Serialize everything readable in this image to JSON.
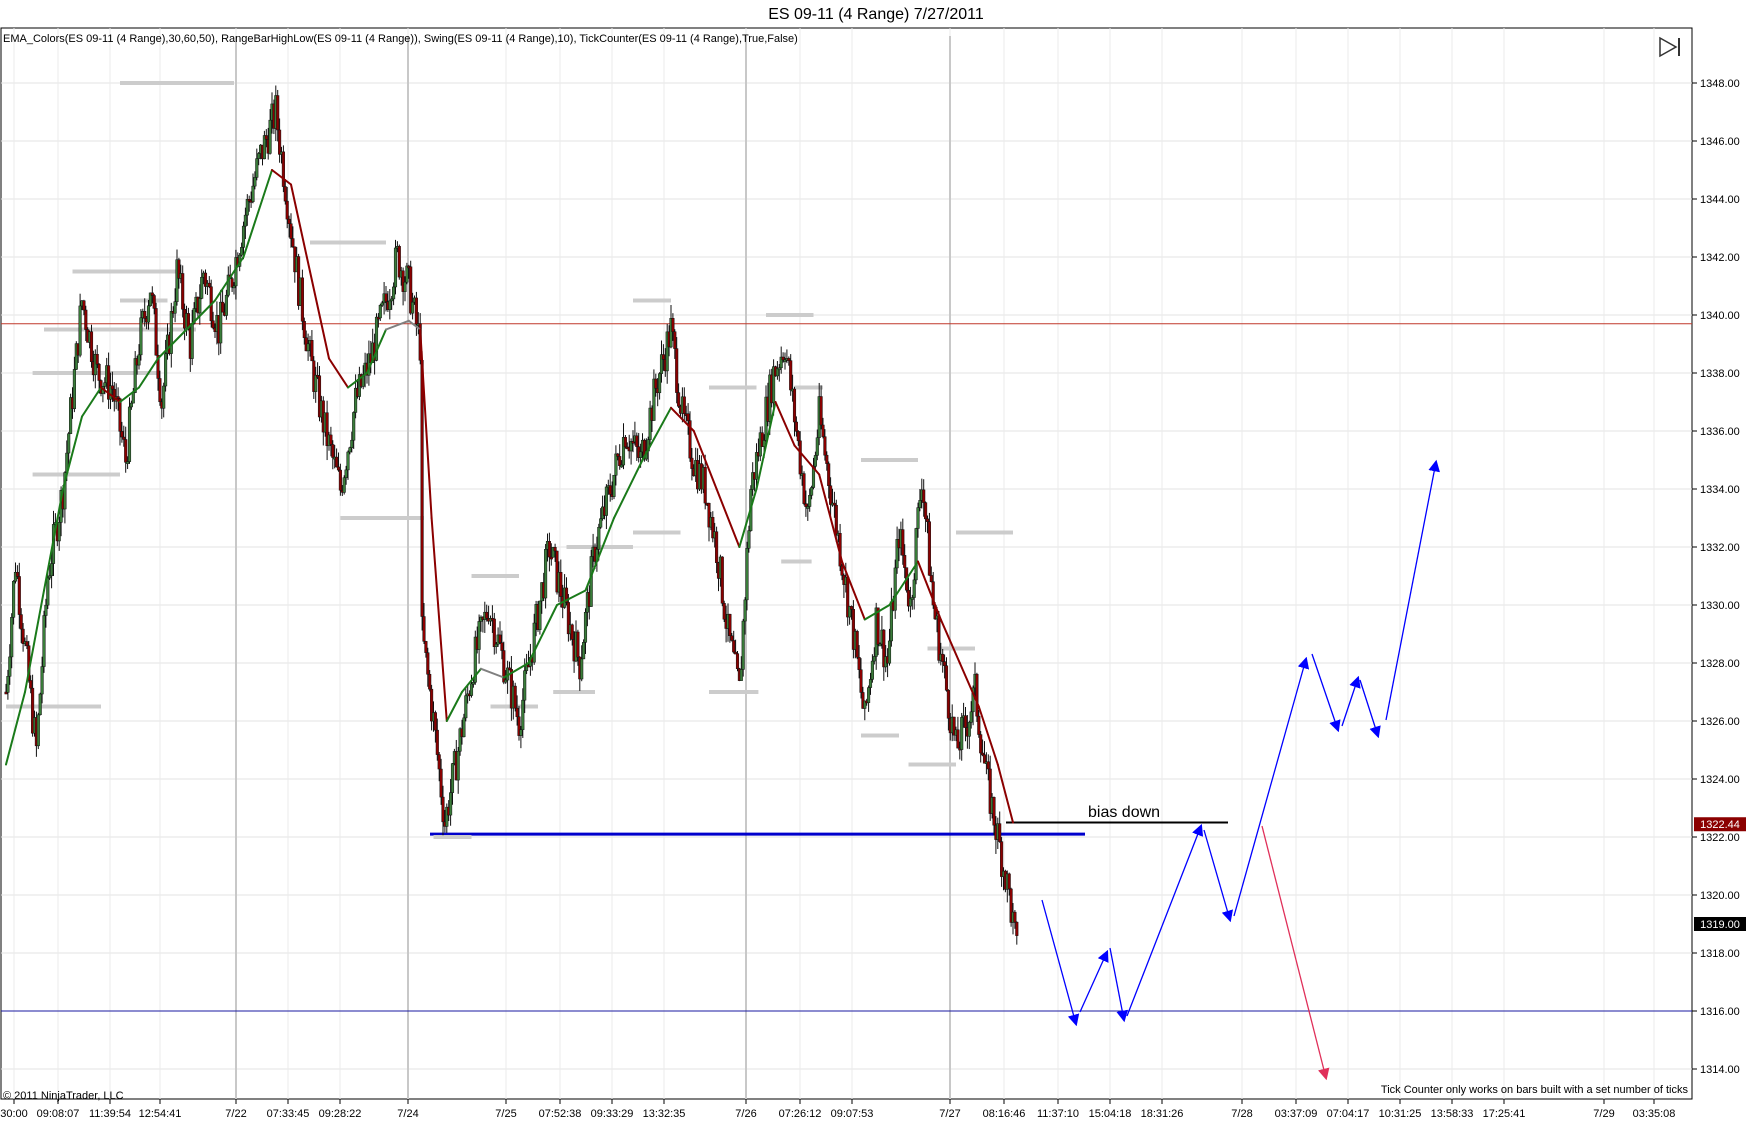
{
  "window": {
    "title": "ES 09-11 (4 Range)  7/27/2011",
    "indicator_line": "EMA_Colors(ES 09-11 (4 Range),30,60,50), RangeBarHighLow(ES 09-11 (4 Range)), Swing(ES 09-11 (4 Range),10), TickCounter(ES 09-11 (4 Range),True,False)",
    "copyright": "© 2011 NinjaTrader, LLC",
    "tick_counter_note": "Tick Counter only works on bars built with a set number of ticks"
  },
  "icons": {
    "scroll_end": "skip-to-end-icon"
  },
  "colors": {
    "up_candle": "#3a7d3a",
    "down_candle": "#8b0000",
    "ema_up": "#1a7a1a",
    "ema_flat": "#808080",
    "ema_down": "#8b0000",
    "swing_marker": "#cccccc",
    "resistance_line": "#c0392b",
    "support_line": "#1a1aa0",
    "annotation_blue": "#0000ff",
    "annotation_red": "#e0305a",
    "black": "#000000"
  },
  "chart_data": {
    "type": "candlestick",
    "title": "ES 09-11 (4 Range)  7/27/2011",
    "ylim": [
      1313,
      1350
    ],
    "y_ticks": [
      "1314.00",
      "1316.00",
      "1318.00",
      "1320.00",
      "1322.00",
      "1324.00",
      "1326.00",
      "1328.00",
      "1330.00",
      "1332.00",
      "1334.00",
      "1336.00",
      "1338.00",
      "1340.00",
      "1342.00",
      "1344.00",
      "1346.00",
      "1348.00"
    ],
    "x_ticks": [
      "30:00",
      "09:08:07",
      "11:39:54",
      "12:54:41",
      "7/22",
      "07:33:45",
      "09:28:22",
      "7/24",
      "7/25",
      "07:52:38",
      "09:33:29",
      "13:32:35",
      "7/26",
      "07:26:12",
      "09:07:53",
      "7/27",
      "08:16:46",
      "11:37:10",
      "15:04:18",
      "18:31:26",
      "7/28",
      "03:37:09",
      "07:04:17",
      "10:31:25",
      "13:58:33",
      "17:25:41",
      "7/29",
      "03:35:08"
    ],
    "price_path": [
      [
        0,
        1327.0
      ],
      [
        5,
        1331.5
      ],
      [
        10,
        1328.5
      ],
      [
        16,
        1325.0
      ],
      [
        22,
        1331.0
      ],
      [
        30,
        1334.0
      ],
      [
        40,
        1340.5
      ],
      [
        48,
        1338.0
      ],
      [
        56,
        1337.5
      ],
      [
        63,
        1335.0
      ],
      [
        70,
        1339.0
      ],
      [
        76,
        1341.0
      ],
      [
        82,
        1337.0
      ],
      [
        90,
        1341.5
      ],
      [
        97,
        1339.0
      ],
      [
        104,
        1341.5
      ],
      [
        112,
        1339.5
      ],
      [
        118,
        1341.0
      ],
      [
        126,
        1343.5
      ],
      [
        134,
        1345.5
      ],
      [
        142,
        1347.0
      ],
      [
        148,
        1344.0
      ],
      [
        154,
        1341.0
      ],
      [
        160,
        1338.5
      ],
      [
        168,
        1336.0
      ],
      [
        176,
        1334.0
      ],
      [
        184,
        1337.0
      ],
      [
        192,
        1338.5
      ],
      [
        198,
        1340.0
      ],
      [
        206,
        1342.0
      ],
      [
        212,
        1341.0
      ],
      [
        218,
        1339.0
      ],
      [
        219,
        1329.0
      ],
      [
        225,
        1326.0
      ],
      [
        231,
        1322.5
      ],
      [
        238,
        1325.0
      ],
      [
        246,
        1328.0
      ],
      [
        254,
        1330.0
      ],
      [
        262,
        1328.0
      ],
      [
        270,
        1326.0
      ],
      [
        278,
        1329.0
      ],
      [
        286,
        1332.0
      ],
      [
        294,
        1330.0
      ],
      [
        302,
        1328.0
      ],
      [
        310,
        1332.0
      ],
      [
        318,
        1334.0
      ],
      [
        326,
        1336.0
      ],
      [
        334,
        1335.0
      ],
      [
        342,
        1337.5
      ],
      [
        350,
        1339.5
      ],
      [
        356,
        1336.5
      ],
      [
        362,
        1335.0
      ],
      [
        368,
        1334.0
      ],
      [
        374,
        1332.0
      ],
      [
        380,
        1329.0
      ],
      [
        386,
        1327.0
      ],
      [
        392,
        1334.0
      ],
      [
        398,
        1336.0
      ],
      [
        404,
        1338.0
      ],
      [
        410,
        1339.0
      ],
      [
        416,
        1336.0
      ],
      [
        422,
        1333.0
      ],
      [
        428,
        1336.5
      ],
      [
        434,
        1334.0
      ],
      [
        440,
        1331.5
      ],
      [
        446,
        1329.0
      ],
      [
        452,
        1326.0
      ],
      [
        458,
        1329.5
      ],
      [
        464,
        1328.0
      ],
      [
        470,
        1332.5
      ],
      [
        476,
        1330.0
      ],
      [
        482,
        1334.5
      ],
      [
        488,
        1330.0
      ],
      [
        494,
        1327.5
      ],
      [
        500,
        1325.0
      ],
      [
        506,
        1326.0
      ],
      [
        510,
        1327.0
      ],
      [
        516,
        1324.0
      ],
      [
        522,
        1322.0
      ],
      [
        528,
        1320.0
      ],
      [
        532,
        1318.0
      ]
    ],
    "ema": [
      [
        0,
        1324.5
      ],
      [
        10,
        1327.0
      ],
      [
        20,
        1330.5
      ],
      [
        30,
        1334.0
      ],
      [
        40,
        1336.5
      ],
      [
        50,
        1337.5
      ],
      [
        60,
        1337.0
      ],
      [
        70,
        1337.5
      ],
      [
        80,
        1338.5
      ],
      [
        95,
        1339.5
      ],
      [
        110,
        1340.5
      ],
      [
        125,
        1342.0
      ],
      [
        140,
        1345.0
      ],
      [
        150,
        1344.5
      ],
      [
        160,
        1341.5
      ],
      [
        170,
        1338.5
      ],
      [
        180,
        1337.5
      ],
      [
        190,
        1338.0
      ],
      [
        200,
        1339.5
      ],
      [
        212,
        1339.8
      ],
      [
        218,
        1339.5
      ],
      [
        224,
        1333.0
      ],
      [
        232,
        1326.0
      ],
      [
        240,
        1327.0
      ],
      [
        250,
        1327.8
      ],
      [
        262,
        1327.5
      ],
      [
        275,
        1328.0
      ],
      [
        290,
        1330.0
      ],
      [
        305,
        1330.5
      ],
      [
        320,
        1333.0
      ],
      [
        335,
        1335.0
      ],
      [
        350,
        1336.8
      ],
      [
        362,
        1336.0
      ],
      [
        374,
        1334.0
      ],
      [
        386,
        1332.0
      ],
      [
        395,
        1334.0
      ],
      [
        405,
        1337.0
      ],
      [
        415,
        1335.5
      ],
      [
        428,
        1334.5
      ],
      [
        440,
        1331.5
      ],
      [
        452,
        1329.5
      ],
      [
        465,
        1330.0
      ],
      [
        480,
        1331.5
      ],
      [
        492,
        1329.5
      ],
      [
        502,
        1328.0
      ],
      [
        512,
        1326.5
      ],
      [
        522,
        1324.5
      ],
      [
        530,
        1322.5
      ]
    ],
    "swing_levels": [
      [
        [
          60,
          120
        ],
        1348.0
      ],
      [
        [
          50,
          90
        ],
        1341.5
      ],
      [
        [
          35,
          70
        ],
        1341.5
      ],
      [
        [
          60,
          85
        ],
        1340.5
      ],
      [
        [
          20,
          100
        ],
        1339.5
      ],
      [
        [
          50,
          80
        ],
        1338.0
      ],
      [
        [
          160,
          200
        ],
        1342.5
      ],
      [
        [
          176,
          220
        ],
        1333.0
      ],
      [
        [
          0,
          50
        ],
        1326.5
      ],
      [
        [
          225,
          245
        ],
        1322.0
      ],
      [
        [
          245,
          270
        ],
        1331.0
      ],
      [
        [
          255,
          280
        ],
        1326.5
      ],
      [
        [
          288,
          310
        ],
        1327.0
      ],
      [
        [
          295,
          330
        ],
        1332.0
      ],
      [
        [
          330,
          350
        ],
        1340.5
      ],
      [
        [
          330,
          355
        ],
        1332.5
      ],
      [
        [
          370,
          395
        ],
        1337.5
      ],
      [
        [
          370,
          396
        ],
        1327.0
      ],
      [
        [
          400,
          425
        ],
        1340.0
      ],
      [
        [
          415,
          430
        ],
        1337.5
      ],
      [
        [
          408,
          424
        ],
        1331.5
      ],
      [
        [
          450,
          480
        ],
        1335.0
      ],
      [
        [
          450,
          470
        ],
        1325.5
      ],
      [
        [
          485,
          510
        ],
        1328.5
      ],
      [
        [
          475,
          500
        ],
        1324.5
      ],
      [
        [
          14,
          60
        ],
        1334.5
      ],
      [
        [
          14,
          55
        ],
        1338.0
      ],
      [
        [
          500,
          530
        ],
        1332.5
      ]
    ],
    "lines": {
      "resistance_price": 1339.7,
      "support_price": 1316.0,
      "blue_level_price": 1322.1,
      "bias_level_price": 1322.5
    },
    "annotations": {
      "bias_label": "bias down",
      "current_price_badge": "1322.44",
      "last_price_badge": "1319.00"
    }
  }
}
